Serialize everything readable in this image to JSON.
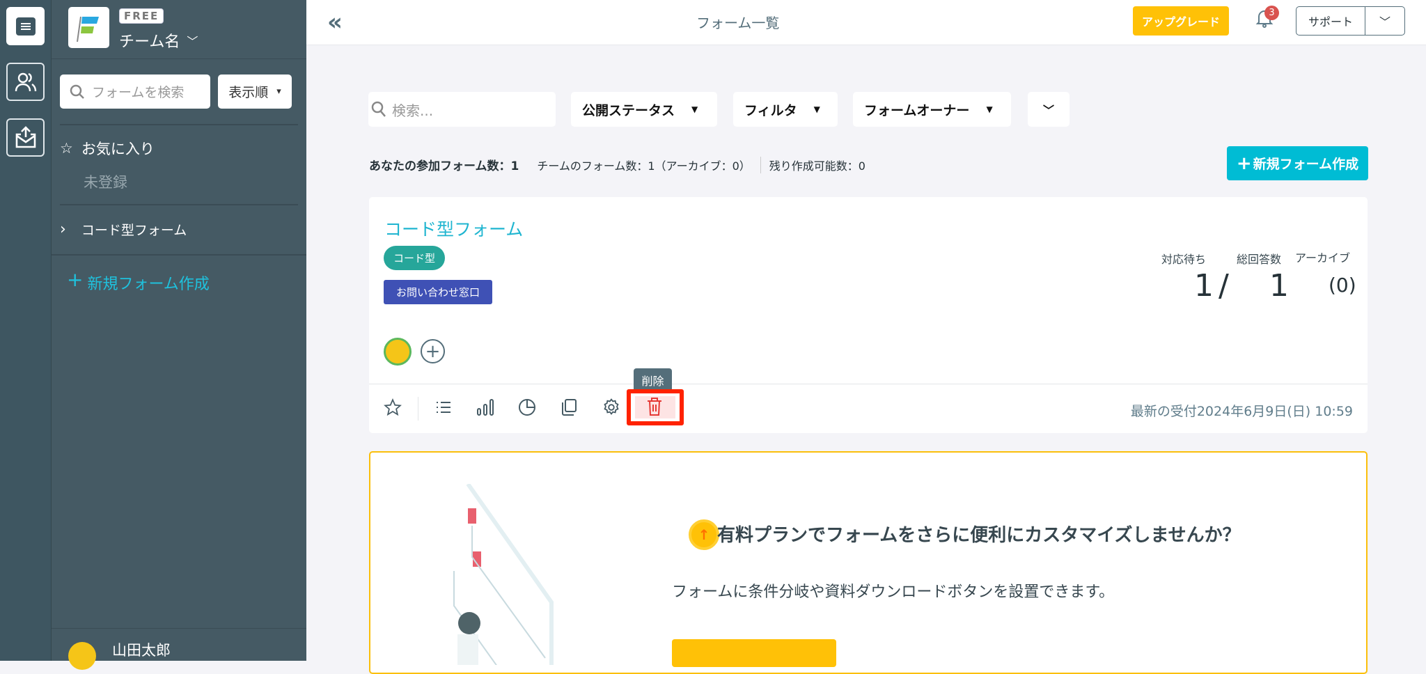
{
  "rail": {
    "icons": [
      "form-list-icon",
      "users-icon",
      "inbox-export-icon"
    ]
  },
  "sidebar": {
    "plan_badge": "FREE",
    "team_name": "チーム名",
    "search_placeholder": "フォームを検索",
    "sort_label": "表示順",
    "favorites_label": "お気に入り",
    "favorites_empty": "未登録",
    "folder_label": "コード型フォーム",
    "new_form_label": "新規フォーム作成",
    "user_name": "山田太郎"
  },
  "header": {
    "title": "フォーム一覧",
    "upgrade_label": "アップグレード",
    "notification_count": "3",
    "support_label": "サポート"
  },
  "toolbar": {
    "search_placeholder": "検索...",
    "status_filter": "公開ステータス",
    "filter": "フィルタ",
    "owner_filter": "フォームオーナー"
  },
  "stats": {
    "participating": "あなたの参加フォーム数：1",
    "team_forms": "チームのフォーム数：1（アーカイブ：0）",
    "remaining": "残り作成可能数：0"
  },
  "new_form_button": "新規フォーム作成",
  "form_card": {
    "title": "コード型フォーム",
    "type_tag": "コード型",
    "category_tag": "お問い合わせ窓口",
    "pending_label": "対応待ち",
    "total_label": "総回答数",
    "archive_label": "アーカイブ",
    "pending_value": "1",
    "slash": "/",
    "total_value": "1",
    "archive_value": "(0)",
    "tooltip": "削除",
    "latest": "最新の受付2024年6月9日(日) 10:59"
  },
  "promo": {
    "title": "有料プランでフォームをさらに便利にカスタマイズしませんか？",
    "description": "フォームに条件分岐や資料ダウンロードボタンを設置できます。"
  },
  "colors": {
    "accent": "#00bcd4",
    "upgrade": "#ffc107",
    "danger": "#ff2200",
    "tag_green": "#26a69a",
    "tag_blue": "#3f51b5"
  }
}
